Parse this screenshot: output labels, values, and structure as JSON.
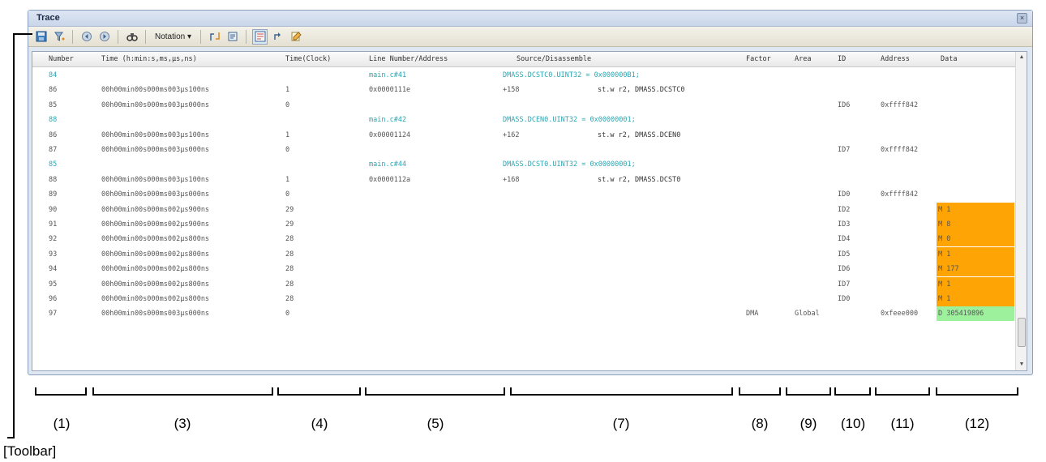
{
  "window": {
    "title": "Trace",
    "close_label": "×"
  },
  "toolbar": {
    "notation_label": "Notation ▾"
  },
  "columns": {
    "number": "Number",
    "time": "Time (h:min:s,ms,μs,ns)",
    "clock": "Time(Clock)",
    "line": "Line Number/Address",
    "source": "Source/Disassemble",
    "factor": "Factor",
    "area": "Area",
    "id": "ID",
    "address": "Address",
    "data": "Data"
  },
  "rows": [
    {
      "num": "84",
      "time": "",
      "clock": "",
      "line": "main.c#41",
      "src1": "DMASS.DCSTC0.UINT32 = 0x000000B1;",
      "src2": "",
      "factor": "",
      "area": "",
      "id": "",
      "address": "",
      "data": ""
    },
    {
      "num": "86",
      "time": "00h00min00s000ms003μs100ns",
      "clock": "1",
      "line": "0x0000111e",
      "src1": "+158",
      "src2": "st.w r2, DMASS.DCSTC0",
      "factor": "",
      "area": "",
      "id": "",
      "address": "",
      "data": ""
    },
    {
      "num": "85",
      "time": "00h00min00s000ms003μs000ns",
      "clock": "0",
      "line": "",
      "src1": "",
      "src2": "",
      "factor": "",
      "area": "",
      "id": "ID6",
      "address": "0xffff842",
      "data": ""
    },
    {
      "num": "88",
      "time": "",
      "clock": "",
      "line": "main.c#42",
      "src1": "DMASS.DCEN0.UINT32 = 0x00000001;",
      "src2": "",
      "factor": "",
      "area": "",
      "id": "",
      "address": "",
      "data": ""
    },
    {
      "num": "86",
      "time": "00h00min00s000ms003μs100ns",
      "clock": "1",
      "line": "0x00001124",
      "src1": "+162",
      "src2": "st.w r2, DMASS.DCEN0",
      "factor": "",
      "area": "",
      "id": "",
      "address": "",
      "data": ""
    },
    {
      "num": "87",
      "time": "00h00min00s000ms003μs000ns",
      "clock": "0",
      "line": "",
      "src1": "",
      "src2": "",
      "factor": "",
      "area": "",
      "id": "ID7",
      "address": "0xffff842",
      "data": ""
    },
    {
      "num": "85",
      "time": "",
      "clock": "",
      "line": "main.c#44",
      "src1": "DMASS.DCST0.UINT32 = 0x00000001;",
      "src2": "",
      "factor": "",
      "area": "",
      "id": "",
      "address": "",
      "data": ""
    },
    {
      "num": "88",
      "time": "00h00min00s000ms003μs100ns",
      "clock": "1",
      "line": "0x0000112a",
      "src1": "+168",
      "src2": "st.w r2, DMASS.DCST0",
      "factor": "",
      "area": "",
      "id": "",
      "address": "",
      "data": ""
    },
    {
      "num": "89",
      "time": "00h00min00s000ms003μs000ns",
      "clock": "0",
      "line": "",
      "src1": "",
      "src2": "",
      "factor": "",
      "area": "",
      "id": "ID0",
      "address": "0xffff842",
      "data": ""
    },
    {
      "num": "90",
      "time": "00h00min00s000ms002μs900ns",
      "clock": "29",
      "line": "",
      "src1": "",
      "src2": "",
      "factor": "",
      "area": "",
      "id": "ID2",
      "address": "",
      "data": "M 1",
      "dcolor": "orange"
    },
    {
      "num": "91",
      "time": "00h00min00s000ms002μs900ns",
      "clock": "29",
      "line": "",
      "src1": "",
      "src2": "",
      "factor": "",
      "area": "",
      "id": "ID3",
      "address": "",
      "data": "M 8",
      "dcolor": "orange"
    },
    {
      "num": "92",
      "time": "00h00min00s000ms002μs800ns",
      "clock": "28",
      "line": "",
      "src1": "",
      "src2": "",
      "factor": "",
      "area": "",
      "id": "ID4",
      "address": "",
      "data": "M 0",
      "dcolor": "orange"
    },
    {
      "num": "93",
      "time": "00h00min00s000ms002μs800ns",
      "clock": "28",
      "line": "",
      "src1": "",
      "src2": "",
      "factor": "",
      "area": "",
      "id": "ID5",
      "address": "",
      "data": "M 1",
      "dcolor": "orange"
    },
    {
      "num": "94",
      "time": "00h00min00s000ms002μs800ns",
      "clock": "28",
      "line": "",
      "src1": "",
      "src2": "",
      "factor": "",
      "area": "",
      "id": "ID6",
      "address": "",
      "data": "M 177",
      "dcolor": "orange"
    },
    {
      "num": "95",
      "time": "00h00min00s000ms002μs800ns",
      "clock": "28",
      "line": "",
      "src1": "",
      "src2": "",
      "factor": "",
      "area": "",
      "id": "ID7",
      "address": "",
      "data": "M 1",
      "dcolor": "orange"
    },
    {
      "num": "96",
      "time": "00h00min00s000ms002μs800ns",
      "clock": "28",
      "line": "",
      "src1": "",
      "src2": "",
      "factor": "",
      "area": "",
      "id": "ID0",
      "address": "",
      "data": "M 1",
      "dcolor": "orange"
    },
    {
      "num": "97",
      "time": "00h00min00s000ms003μs000ns",
      "clock": "0",
      "line": "",
      "src1": "",
      "src2": "",
      "factor": "DMA",
      "area": "Global",
      "id": "",
      "address": "0xfeee000",
      "data": "D 305419896",
      "dcolor": "green"
    }
  ],
  "callouts": [
    "(1)",
    "(3)",
    "(4)",
    "(5)",
    "(7)",
    "(8)",
    "(9)",
    "(10)",
    "(11)",
    "(12)"
  ],
  "toolbar_callout": "[Toolbar]"
}
